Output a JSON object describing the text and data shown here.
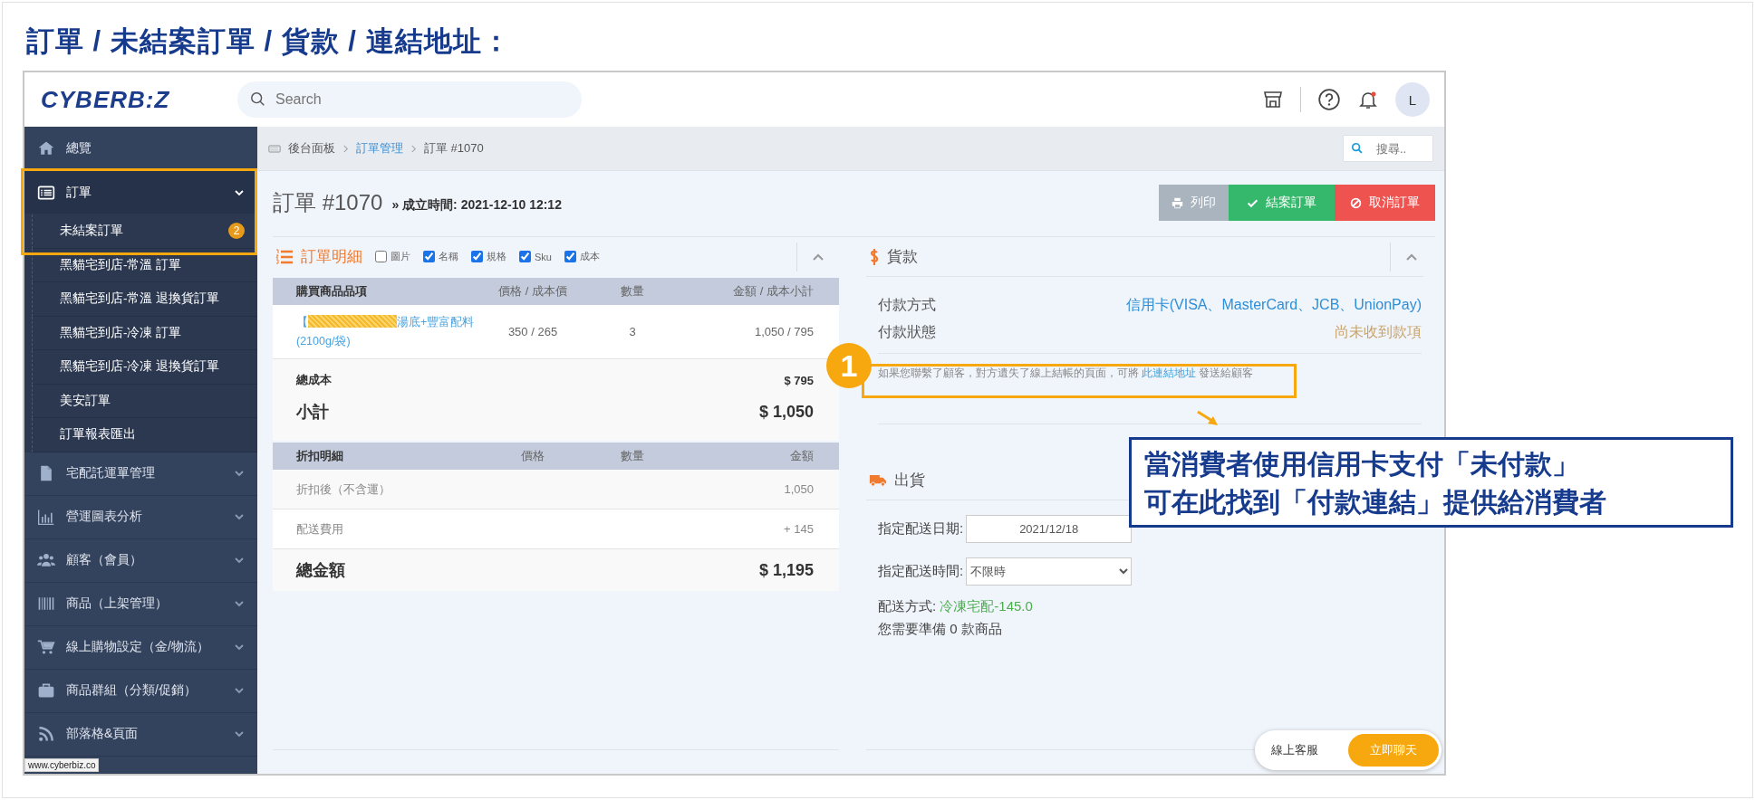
{
  "heading": "訂單 / 未結案訂單 / 貨款 / 連結地址：",
  "header": {
    "logo": "CYBERB:Z",
    "search": {
      "placeholder": "Search"
    },
    "avatar": "L"
  },
  "sidebar": {
    "items": [
      {
        "label": "總覽",
        "selected": false
      },
      {
        "label": "訂單",
        "selected": true,
        "expanded": true,
        "children": [
          {
            "label": "未結案訂單",
            "badge": "2"
          },
          {
            "label": "黑貓宅到店-常溫 訂單"
          },
          {
            "label": "黑貓宅到店-常溫 退換貨訂單"
          },
          {
            "label": "黑貓宅到店-冷凍 訂單"
          },
          {
            "label": "黑貓宅到店-冷凍 退換貨訂單"
          },
          {
            "label": "美安訂單"
          },
          {
            "label": "訂單報表匯出"
          }
        ]
      },
      {
        "label": "宅配託運單管理",
        "selected": false,
        "expanded": false
      },
      {
        "label": "營運圖表分析",
        "selected": false,
        "expanded": false
      },
      {
        "label": "顧客（會員）",
        "selected": false,
        "expanded": false
      },
      {
        "label": "商品（上架管理）",
        "selected": false,
        "expanded": false
      },
      {
        "label": "線上購物設定（金/物流）",
        "selected": false,
        "expanded": false
      },
      {
        "label": "商品群組（分類/促銷）",
        "selected": false,
        "expanded": false
      },
      {
        "label": "部落格&頁面",
        "selected": false,
        "expanded": false
      }
    ]
  },
  "breadcrumb": [
    {
      "label": "後台面板",
      "link": false
    },
    {
      "label": "訂單管理",
      "link": true
    },
    {
      "label": "訂單 #1070",
      "link": false
    }
  ],
  "search": {
    "placeholder": "搜尋.."
  },
  "order": {
    "title": "訂單 #1070",
    "created": "» 成立時間: 2021-12-10 12:12"
  },
  "buttons": [
    {
      "label": "列印",
      "kind": "print"
    },
    {
      "label": "結案訂單",
      "kind": "close"
    },
    {
      "label": "取消訂單",
      "kind": "cancel"
    }
  ],
  "order_details": {
    "title": "訂單明細",
    "toggles": [
      {
        "label": "圖片",
        "checked": false
      },
      {
        "label": "名稱",
        "checked": true
      },
      {
        "label": "規格",
        "checked": true
      },
      {
        "label": "Sku",
        "checked": true
      },
      {
        "label": "成本",
        "checked": true
      }
    ],
    "columns": [
      "購買商品品項",
      "價格 / 成本價",
      "數量",
      "金額 / 成本小計"
    ],
    "items": [
      {
        "name_start": "【",
        "name_end": "湯底+豐富配料(2100g/袋)",
        "price": "350 / 265",
        "qty": "3",
        "amount": "1,050 / 795"
      }
    ],
    "total_cost": {
      "label": "總成本",
      "value": "$ 795"
    },
    "subtotal": {
      "label": "小計",
      "value": "$ 1,050"
    },
    "discount_columns": [
      "折扣明細",
      "價格",
      "數量",
      "金額"
    ],
    "discount_rows": [
      {
        "label": "折扣後（不含運）",
        "value": "1,050"
      },
      {
        "label": "配送費用",
        "value": "+ 145"
      }
    ],
    "total": {
      "label": "總金額",
      "value": "$ 1,195"
    }
  },
  "payment": {
    "title": "貨款",
    "rows": [
      {
        "label": "付款方式",
        "value": "信用卡(VISA、MasterCard、JCB、UnionPay)",
        "kind": "method"
      },
      {
        "label": "付款狀態",
        "value": "尚未收到款項",
        "kind": "status"
      }
    ],
    "note": {
      "before": "如果您聯繫了顧客，對方遺失了線上結帳的頁面，可將",
      "link": "此連結地址",
      "after": "發送給顧客"
    }
  },
  "shipping": {
    "title": "出貨",
    "date_label": "指定配送日期:",
    "date": "2021/12/18",
    "time_label": "指定配送時間:",
    "time": "不限時",
    "method_label": "配送方式:",
    "method": "冷凍宅配-145.0",
    "prepare": "您需要準備 0 款商品"
  },
  "chat": {
    "label": "線上客服",
    "button": "立即聊天"
  },
  "status_url": "www.cyberbiz.co",
  "annotation": {
    "badge": "1",
    "callout": [
      "當消費者使用信用卡支付「未付款」",
      "可在此找到「付款連結」提供給消費者"
    ]
  }
}
